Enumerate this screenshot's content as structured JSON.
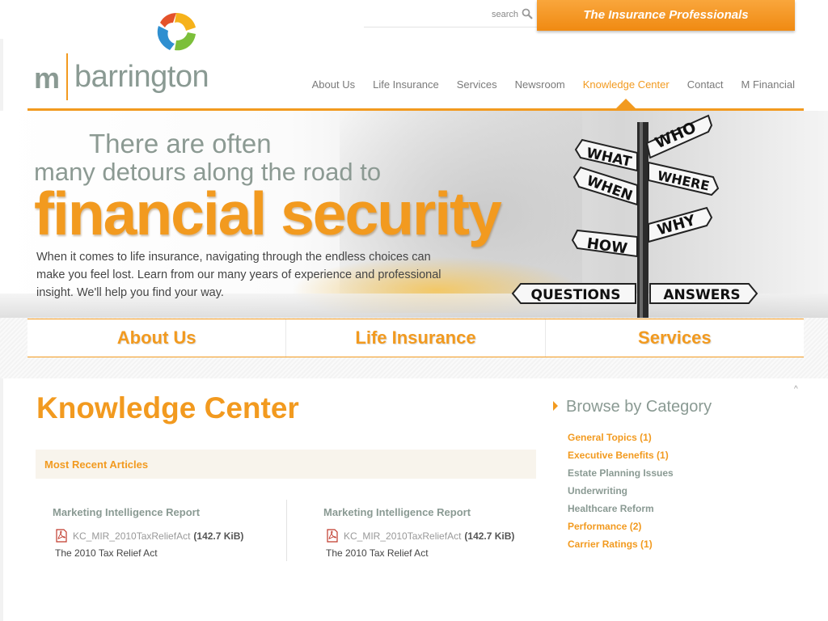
{
  "header": {
    "search_label": "search",
    "tagline": "The Insurance Professionals",
    "logo": {
      "initial": "m",
      "word": "barrington"
    }
  },
  "nav": {
    "items": [
      {
        "label": "About Us"
      },
      {
        "label": "Life Insurance"
      },
      {
        "label": "Services"
      },
      {
        "label": "Newsroom"
      },
      {
        "label": "Knowledge Center"
      },
      {
        "label": "Contact"
      },
      {
        "label": "M Financial"
      }
    ],
    "active": "Knowledge Center"
  },
  "hero": {
    "line1": "There are often",
    "line2": "many detours along the road to",
    "line3": "financial security",
    "body": "When it comes to life insurance, navigating through the endless choices can make you feel lost. Learn from our many years of experience and professional insight. We'll help you find your way.",
    "signs": [
      "WHO",
      "WHAT",
      "WHERE",
      "WHEN",
      "WHY",
      "HOW",
      "QUESTIONS",
      "ANSWERS"
    ]
  },
  "big_tabs": [
    {
      "label": "About Us"
    },
    {
      "label": "Life Insurance"
    },
    {
      "label": "Services"
    }
  ],
  "main": {
    "title": "Knowledge Center",
    "recent_label": "Most Recent Articles",
    "articles": [
      {
        "title": "Marketing Intelligence Report",
        "file": "KC_MIR_2010TaxReliefAct",
        "size": "(142.7 KiB)",
        "desc": "The 2010 Tax Relief Act"
      },
      {
        "title": "Marketing Intelligence Report",
        "file": "KC_MIR_2010TaxReliefAct",
        "size": "(142.7 KiB)",
        "desc": "The 2010 Tax Relief Act"
      }
    ]
  },
  "sidebar": {
    "title": "Browse by Category",
    "categories": [
      {
        "label": "General Topics (1)"
      },
      {
        "label": "Executive Benefits (1)"
      },
      {
        "label": "Estate Planning Issues"
      },
      {
        "label": "Underwriting"
      },
      {
        "label": "Healthcare Reform"
      },
      {
        "label": "Performance (2)"
      },
      {
        "label": "Carrier Ratings (1)"
      }
    ]
  },
  "misc": {
    "caret": "^"
  },
  "colors": {
    "accent": "#f29a1f",
    "gray_text": "#8a9a93"
  }
}
